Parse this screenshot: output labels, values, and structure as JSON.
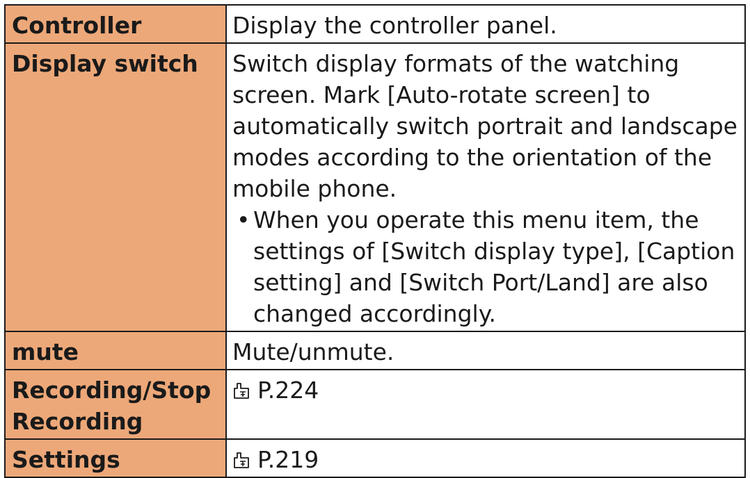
{
  "rows": [
    {
      "name": "Controller",
      "description": "Display the controller panel."
    },
    {
      "name": "Display switch",
      "description": "Switch display formats of the watching screen. Mark [Auto-rotate screen] to automatically switch portrait and landscape modes according to the orientation of the mobile phone.",
      "note": "When you operate this menu item, the settings of [Switch display type], [Caption setting] and [Switch Port/Land] are also changed accordingly."
    },
    {
      "name": "mute",
      "description": "Mute/unmute."
    },
    {
      "name": "Recording/Stop Recording",
      "reference": "P.224",
      "reference_icon": "page-reference-icon"
    },
    {
      "name": "Settings",
      "reference": "P.219",
      "reference_icon": "page-reference-icon"
    }
  ],
  "bullet_glyph": "•"
}
